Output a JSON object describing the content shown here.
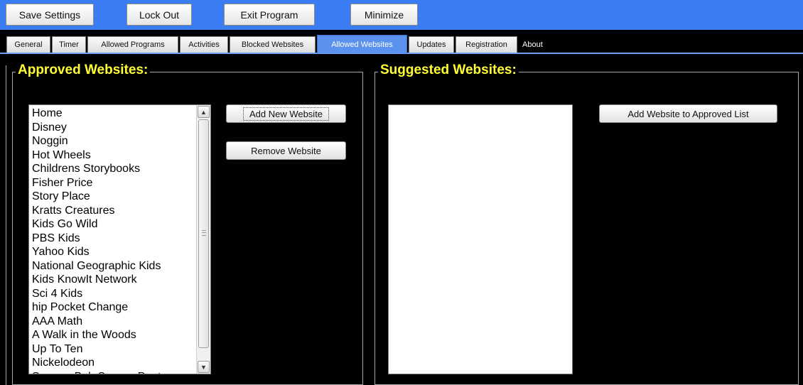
{
  "toolbar": {
    "save_label": "Save Settings",
    "lock_label": "Lock Out",
    "exit_label": "Exit Program",
    "minimize_label": "Minimize"
  },
  "tabs": [
    {
      "label": "General"
    },
    {
      "label": "Timer"
    },
    {
      "label": "Allowed Programs"
    },
    {
      "label": "Activities"
    },
    {
      "label": "Blocked Websites"
    },
    {
      "label": "Allowed Websites",
      "active": true
    },
    {
      "label": "Updates"
    },
    {
      "label": "Registration"
    },
    {
      "label": "About"
    }
  ],
  "approved": {
    "title": "Approved Websites:",
    "items": [
      "Home",
      "Disney",
      "Noggin",
      "Hot Wheels",
      "Childrens Storybooks",
      "Fisher Price",
      "Story Place",
      "Kratts Creatures",
      "Kids Go Wild",
      "PBS Kids",
      "Yahoo Kids",
      "National Geographic Kids",
      "Kids KnowIt Network",
      "Sci 4 Kids",
      "hip Pocket Change",
      "AAA Math",
      "A Walk in the Woods",
      "Up To Ten",
      "Nickelodeon",
      "Sponge Bob Square Pants"
    ],
    "add_label": "Add New Website",
    "remove_label": "Remove Website"
  },
  "suggested": {
    "title": "Suggested Websites:",
    "items": [],
    "add_label": "Add Website to Approved List"
  },
  "colors": {
    "toolbar_bg": "#3a7df3",
    "title_yellow": "#ffff33",
    "active_tab": "#5b92f0"
  }
}
